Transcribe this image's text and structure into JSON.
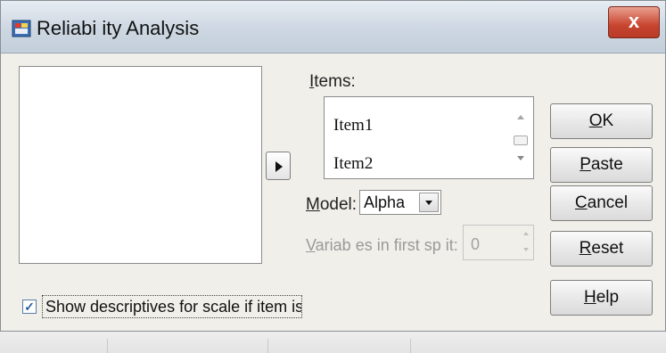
{
  "window": {
    "title": "Reliabi ity Analysis",
    "close_glyph": "x"
  },
  "transfer_button": {
    "icon": "right-arrow-icon"
  },
  "items": {
    "label": "Items:",
    "list": [
      "Item1",
      "Item2"
    ]
  },
  "model": {
    "label": "Model:",
    "value": "Alpha"
  },
  "split": {
    "label": "Variab es in first sp it:",
    "value": "0"
  },
  "buttons": {
    "ok": "OK",
    "paste": "Paste",
    "cancel": "Cancel",
    "reset": "Reset",
    "help": "Help"
  },
  "descriptives": {
    "checked": true,
    "label": "Show descriptives for scale if item is deleted"
  },
  "colors": {
    "close_button": "#c8452f",
    "titlebar": "#cdd7e2",
    "dialog_bg": "#f0efe9"
  }
}
